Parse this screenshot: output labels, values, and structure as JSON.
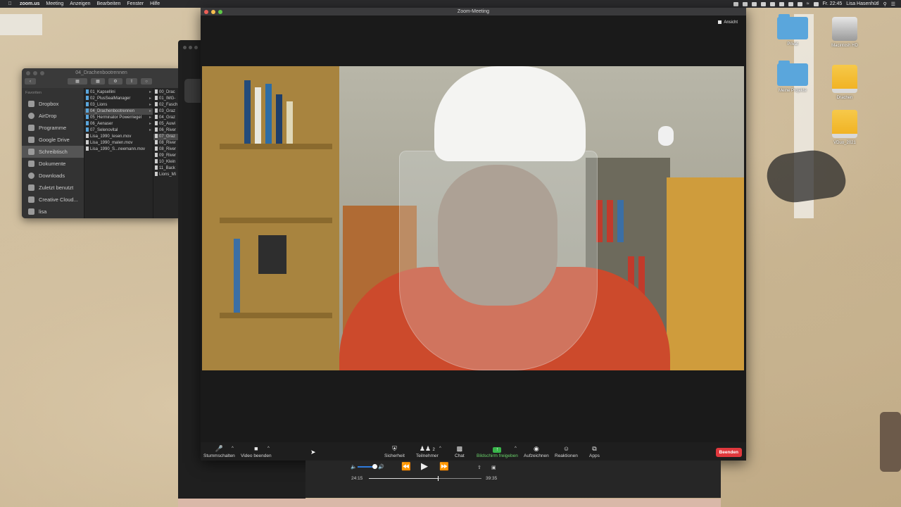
{
  "menubar": {
    "app": "zoom.us",
    "items": [
      "Meeting",
      "Anzeigen",
      "Bearbeiten",
      "Fenster",
      "Hilfe"
    ],
    "time": "Fr. 22:45",
    "user": "Lisa Hasenhütl"
  },
  "desktop_icons": {
    "privat": "Privat",
    "macintosh_hd": "Macintosh HD",
    "meine_projekte": "Meine Projekte",
    "drachen": "Drachen",
    "vduo": "VDuo_2021"
  },
  "finder": {
    "title": "04_Drachenbootrennen",
    "sidebar_heading": "Favoriten",
    "sidebar": [
      "Dropbox",
      "AirDrop",
      "Programme",
      "Google Drive",
      "Schreibtisch",
      "Dokumente",
      "Downloads",
      "Zuletzt benutzt",
      "Creative Cloud...",
      "lisa"
    ],
    "col1": [
      "01_Kapsellini",
      "02_PlusSealManager",
      "03_Lions",
      "04_Drachenbootrennen",
      "05_Herminator Powerriegel",
      "06_Aenaser",
      "07_Selenovital",
      "Lisa_1990_lesen.mov",
      "Lisa_1990_malen.mov",
      "Lisa_1990_S...neemann.mov"
    ],
    "col2": [
      "00_Drac",
      "01_IMG-",
      "02_Fasch",
      "03_Graz",
      "04_Graz",
      "05_Auwi",
      "06_River",
      "07_Graz",
      "08_River",
      "08_River",
      "09_River",
      "10_Klein",
      "11_Back",
      "Lions_Mi"
    ]
  },
  "zoom": {
    "title": "Zoom-Meeting",
    "view_label": "Ansicht",
    "toolbar": {
      "mute": "Stummschalten",
      "video": "Video beenden",
      "security": "Sicherheit",
      "participants": "Teilnehmer",
      "participant_count": "2",
      "chat": "Chat",
      "share": "Bildschirm freigeben",
      "record": "Aufzeichnen",
      "reactions": "Reaktionen",
      "apps": "Apps",
      "end": "Beenden"
    }
  },
  "player": {
    "elapsed": "24:15",
    "total": "39:35",
    "progress": 0.61,
    "volume": 0.8
  },
  "colors": {
    "end_button": "#e0383d",
    "share_green": "#38b54a",
    "volume_blue": "#2f7bdc"
  }
}
